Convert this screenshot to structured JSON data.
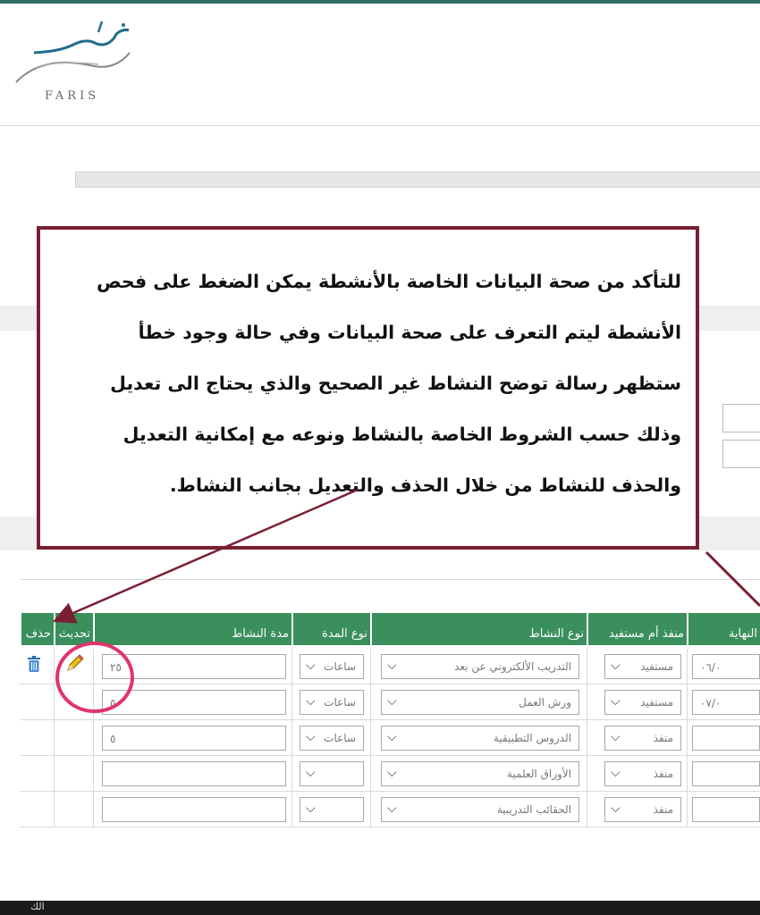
{
  "logo": {
    "wordmark": "فارس",
    "text": "FARIS"
  },
  "annotation": {
    "lines": [
      "للتأكد من صحة البيانات الخاصة بالأنشطة يمكن الضغط على فحص",
      "الأنشطة ليتم التعرف على صحة البيانات وفي حالة وجود خطأ",
      "ستظهر رسالة توضح النشاط غير الصحيح والذي يحتاج الى تعديل",
      "وذلك حسب الشروط الخاصة بالنشاط ونوعه مع إمكانية التعديل",
      "والحذف للنشاط من خلال الحذف والتعديل بجانب النشاط."
    ],
    "border_color": "#7a1f33",
    "highlight_color": "#e0346e"
  },
  "table": {
    "header_color": "#3a8f5c",
    "headers": {
      "delete": "حذف",
      "update": "تحديث",
      "duration": "مدة النشاط",
      "duration_type": "نوع المدة",
      "activity_type": "نوع النشاط",
      "executor": "منفذ أم مستفيد",
      "end": "النهاية"
    },
    "rows": [
      {
        "end": "٠٦/٠",
        "executor": "مستفيد",
        "activity": "التدريب الألكتروني عن بعد",
        "duration_type": "ساعات",
        "duration": "٢٥",
        "has_actions": true
      },
      {
        "end": "٠٧/٠",
        "executor": "مستفيد",
        "activity": "ورش العمل",
        "duration_type": "ساعات",
        "duration": "٥",
        "has_actions": false
      },
      {
        "end": "",
        "executor": "منفذ",
        "activity": "الدروس التطبيقية",
        "duration_type": "ساعات",
        "duration": "٥",
        "has_actions": false
      },
      {
        "end": "",
        "executor": "منفذ",
        "activity": "الأوراق العلمية",
        "duration_type": "",
        "duration": "",
        "has_actions": false
      },
      {
        "end": "",
        "executor": "منفذ",
        "activity": "الحقائب التدريبية",
        "duration_type": "",
        "duration": "",
        "has_actions": false
      }
    ]
  },
  "taskbar": {
    "text": "الك"
  },
  "icons": [
    "logo-bird-icon",
    "trash-icon",
    "pencil-icon",
    "chevron-down-icon",
    "arrow-icon"
  ]
}
